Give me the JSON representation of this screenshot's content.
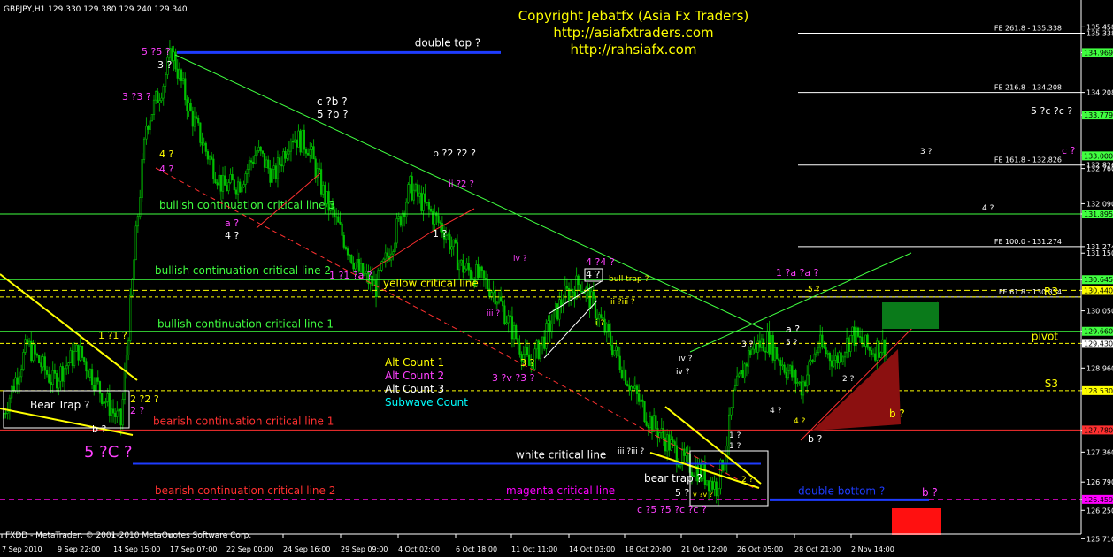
{
  "symbol_header": "GBPJPY,H1  129.330 129.380 129.240 129.340",
  "copyright": {
    "line1": "Copyright Jebatfx (Asia Fx Traders)",
    "line2": "http://asiafxtraders.com",
    "line3": "http://rahsiafx.com"
  },
  "footer": "FXDD - MetaTrader, © 2001-2010 MetaQuotes Software Corp.",
  "legend": {
    "alt1": "Alt Count 1",
    "alt2": "Alt Count 2",
    "alt3": "Alt Count 3",
    "sub": "Subwave Count"
  },
  "colors": {
    "background": "#000000",
    "grid": "#ffffff",
    "candle": "#00a000",
    "green_line": "#40ff40",
    "blue_line": "#1e3cff",
    "red_line": "#ff3030",
    "yellow": "#ffff00",
    "magenta": "#ff00ff",
    "cyan": "#00ffff"
  },
  "chart_data": {
    "type": "candlestick",
    "symbol": "GBPJPY",
    "timeframe": "H1",
    "ohlc_current": {
      "open": 129.33,
      "high": 129.38,
      "low": 129.24,
      "close": 129.34
    },
    "ylim": [
      125.8,
      135.7
    ],
    "y_ticks": [
      "135.458",
      "135.338",
      "134.969",
      "134.208",
      "133.779",
      "133.000",
      "132.826",
      "132.760",
      "132.090",
      "131.895",
      "131.274",
      "131.150",
      "130.645",
      "130.440",
      "130.050",
      "129.660",
      "129.430",
      "128.960",
      "128.530",
      "127.780",
      "127.360",
      "126.790",
      "126.459",
      "126.250",
      "125.710"
    ],
    "x_ticks": [
      "7 Sep 2010",
      "9 Sep 22:00",
      "14 Sep 15:00",
      "17 Sep 07:00",
      "22 Sep 00:00",
      "24 Sep 16:00",
      "29 Sep 09:00",
      "4 Oct 02:00",
      "6 Oct 18:00",
      "11 Oct 11:00",
      "14 Oct 03:00",
      "18 Oct 20:00",
      "21 Oct 12:00",
      "26 Oct 05:00",
      "28 Oct 21:00",
      "2 Nov 14:00"
    ],
    "price_path": [
      [
        0,
        128.0
      ],
      [
        3,
        129.4
      ],
      [
        6,
        128.7
      ],
      [
        9,
        129.3
      ],
      [
        12,
        128.4
      ],
      [
        14,
        127.9
      ],
      [
        16,
        131.9
      ],
      [
        17,
        133.6
      ],
      [
        19,
        134.4
      ],
      [
        20,
        135.0
      ],
      [
        22,
        133.9
      ],
      [
        24,
        133.1
      ],
      [
        26,
        132.4
      ],
      [
        28,
        132.5
      ],
      [
        30,
        133.1
      ],
      [
        32,
        132.6
      ],
      [
        34,
        133.4
      ],
      [
        36,
        133.2
      ],
      [
        38,
        132.2
      ],
      [
        40,
        131.5
      ],
      [
        42,
        130.8
      ],
      [
        44,
        130.5
      ],
      [
        46,
        131.4
      ],
      [
        48,
        132.4
      ],
      [
        50,
        132.0
      ],
      [
        52,
        131.6
      ],
      [
        54,
        130.9
      ],
      [
        56,
        130.7
      ],
      [
        58,
        130.4
      ],
      [
        60,
        129.7
      ],
      [
        62,
        129.0
      ],
      [
        64,
        129.6
      ],
      [
        66,
        130.3
      ],
      [
        68,
        130.6
      ],
      [
        70,
        130.0
      ],
      [
        72,
        129.3
      ],
      [
        74,
        128.6
      ],
      [
        76,
        128.0
      ],
      [
        78,
        127.6
      ],
      [
        80,
        127.2
      ],
      [
        82,
        127.0
      ],
      [
        84,
        126.7
      ],
      [
        85,
        127.3
      ],
      [
        86,
        128.4
      ],
      [
        88,
        129.3
      ],
      [
        90,
        129.5
      ],
      [
        92,
        129.0
      ],
      [
        94,
        128.6
      ],
      [
        96,
        129.4
      ],
      [
        98,
        129.1
      ],
      [
        100,
        129.6
      ],
      [
        102,
        129.3
      ],
      [
        104,
        129.4
      ]
    ],
    "horizontal_lines": [
      {
        "label": "double top ?",
        "price": 134.969,
        "color": "#1e3cff"
      },
      {
        "label": "bullish continuation critical line 3",
        "price": 131.895,
        "color": "#40ff40"
      },
      {
        "label": "bullish continuation critical line 2",
        "price": 130.645,
        "color": "#40ff40"
      },
      {
        "label": "yellow critical line",
        "price": 130.44,
        "color": "#ffff00"
      },
      {
        "label": "bullish continuation critical line 1",
        "price": 129.66,
        "color": "#40ff40"
      },
      {
        "label": "bearish continuation critical line 1",
        "price": 127.78,
        "color": "#ff3030"
      },
      {
        "label": "white critical line",
        "price": 127.56,
        "color": "#ffffff"
      },
      {
        "label": "bearish continuation critical line 2",
        "price": 126.459,
        "color": "#ff3030"
      },
      {
        "label": "magenta critical line",
        "price": 126.459,
        "color": "#ff00ff"
      },
      {
        "label": "double bottom ?",
        "price": 126.45,
        "color": "#1e3cff"
      }
    ],
    "fib_levels": [
      {
        "label": "FE 261.8 - 135.338",
        "price": 135.338
      },
      {
        "label": "FE 216.8 - 134.208",
        "price": 134.208
      },
      {
        "label": "FE 161.8 - 132.826",
        "price": 132.826
      },
      {
        "label": "FE 100.0 - 131.274",
        "price": 131.274
      },
      {
        "label": "FE 61.8 - 130.314",
        "price": 130.314
      }
    ],
    "pivot_labels": {
      "r3": "R3",
      "pivot": "pivot",
      "s3": "S3"
    },
    "price_tags": [
      "134.969",
      "133.779",
      "133.000",
      "131.895",
      "130.645",
      "130.440",
      "129.660",
      "129.430",
      "128.530",
      "127.780",
      "126.459"
    ],
    "annotations": {
      "bear_trap_left": "Bear Trap ?",
      "bear_trap_right": "bear trap ?",
      "bull_trap": "bull trap ?",
      "big_5c": "5 ?C ?",
      "waves": [
        "5 ?5 ?",
        "3 ?",
        "3 ?3 ?",
        "4 ?",
        "4 ?",
        "c ?b ?",
        "5 ?b ?",
        "b ?2 ?2 ?",
        "ii ?2 ?",
        "a ?",
        "4 ?",
        "1 ?",
        "1 ?1 ?a ?",
        "iv ?",
        "iii ?",
        "4 ?4 ?",
        "4 ?",
        "ii ?iii ?",
        "i ?",
        "3 ?",
        "3 ?v ?3 ?",
        "1 ?1 ?",
        "2 ?2 ?",
        "2 ?",
        "b ?",
        "iii ?iii ?",
        "iv ?",
        "iv ?",
        "5 ?",
        "1 ?",
        "1 ?",
        "2 ?",
        "c ?5 ?5 ?c ?c ?",
        "v ?v ?",
        "3 ?",
        "a ?",
        "5 ?",
        "4 ?",
        "4 ?",
        "2 ?",
        "b ?",
        "1 ?a ?a ?",
        "5 ?",
        "3 ?",
        "4 ?",
        "5 ?c ?c ?",
        "c ?",
        "b ?",
        "b ?"
      ]
    }
  }
}
